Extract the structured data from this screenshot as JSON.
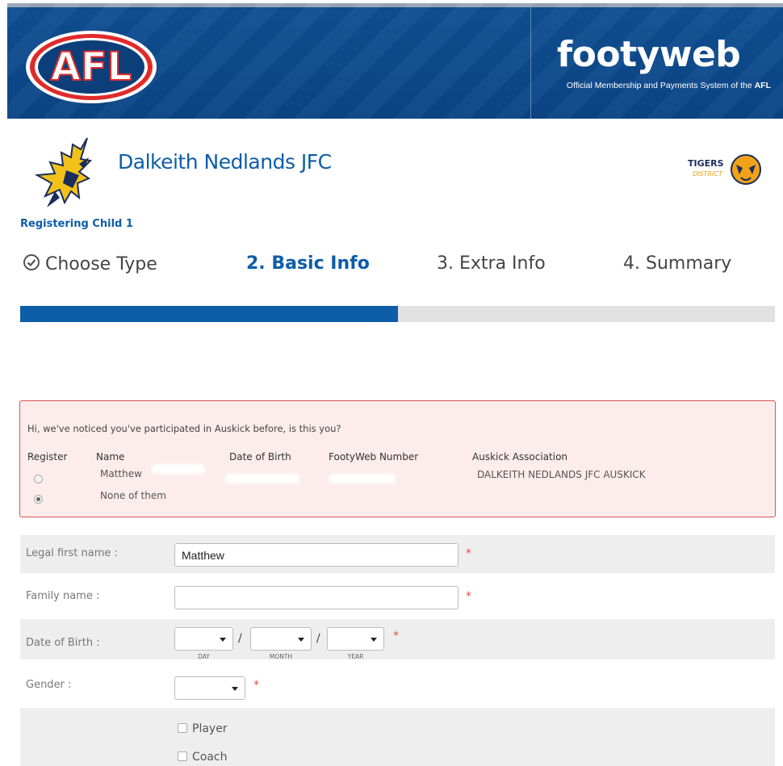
{
  "header": {
    "afl_logo_text": "AFL",
    "brand_title": "footyweb",
    "brand_subtitle_prefix": "Official Membership and Payments System of the ",
    "brand_subtitle_bold": "AFL"
  },
  "club": {
    "name": "Dalkeith Nedlands JFC",
    "partner_logo_text": "TIGERS",
    "partner_logo_subtext": "DISTRICT"
  },
  "registering_label": "Registering Child 1",
  "steps": [
    {
      "label": "Choose Type",
      "state": "done"
    },
    {
      "label": "2. Basic Info",
      "state": "active"
    },
    {
      "label": "3. Extra Info",
      "state": "pending"
    },
    {
      "label": "4. Summary",
      "state": "pending"
    }
  ],
  "progress_fraction": 0.5,
  "notice": {
    "message": "Hi, we've noticed you've participated in Auskick before, is this you?",
    "headers": {
      "register": "Register",
      "name": "Name",
      "dob": "Date of Birth",
      "footyweb_number": "FootyWeb Number",
      "association": "Auskick Association"
    },
    "rows": [
      {
        "name": "Matthew",
        "association": "DALKEITH NEDLANDS JFC AUSKICK",
        "selected": false
      },
      {
        "name": "None of them",
        "association": "",
        "selected": true
      }
    ]
  },
  "form": {
    "first_name": {
      "label": "Legal first name :",
      "value": "Matthew"
    },
    "family_name": {
      "label": "Family name :",
      "value": ""
    },
    "dob": {
      "label": "Date of Birth :",
      "separator": "/",
      "day_label": "DAY",
      "month_label": "MONTH",
      "year_label": "YEAR",
      "day_value": "",
      "month_value": "",
      "year_value": ""
    },
    "gender": {
      "label": "Gender :",
      "value": ""
    },
    "roles": [
      {
        "label": "Player",
        "checked": false
      },
      {
        "label": "Coach",
        "checked": false
      }
    ],
    "required_marker": "*"
  },
  "colors": {
    "banner_blue": "#0b4586",
    "brand_blue": "#0d5da8",
    "required_red": "#d9534f",
    "notice_bg": "#fdecec"
  }
}
